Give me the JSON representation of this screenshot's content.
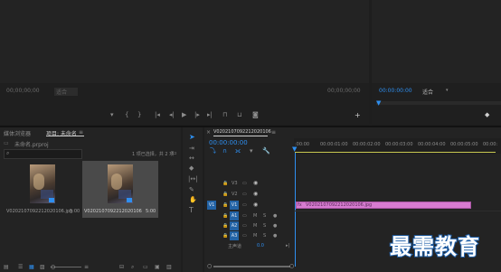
{
  "source_monitor": {
    "timecode_left": "00;00;00;00",
    "fit_label": "适合",
    "timecode_right": "00;00;00;00"
  },
  "program_monitor": {
    "timecode": "00:00:00:00",
    "fit_label": "适合"
  },
  "project_panel": {
    "tab_media_browser": "媒体浏览器",
    "tab_project": "项目: 未命名",
    "project_file": "未命名.prproj",
    "selection_info": "1 项已选择，共 2 项",
    "clips": [
      {
        "name": "V0202107092212020106.jpg",
        "duration": "5:00"
      },
      {
        "name": "V0202107092212020106",
        "duration": "5:00"
      }
    ]
  },
  "timeline": {
    "tab_label": "V0202107092212020106",
    "timecode": "00:00:00:00",
    "ruler": [
      ":00:00",
      "00:00:01:00",
      "00:00:02:00",
      "00:00:03:00",
      "00:00:04:00",
      "00:00:05:00",
      "00:00:"
    ],
    "video_tracks": [
      "V3",
      "V2",
      "V1"
    ],
    "audio_tracks": [
      "A1",
      "A2",
      "A3"
    ],
    "master_label": "主声道",
    "master_value": "0.0",
    "clip_label": "V0202107092212020106.jpg",
    "clip_fx": "fx"
  },
  "watermark": "最需教育",
  "colors": {
    "accent": "#2e8ff0",
    "clip": "#d77bd0",
    "playhead": "#2e8ff0"
  }
}
